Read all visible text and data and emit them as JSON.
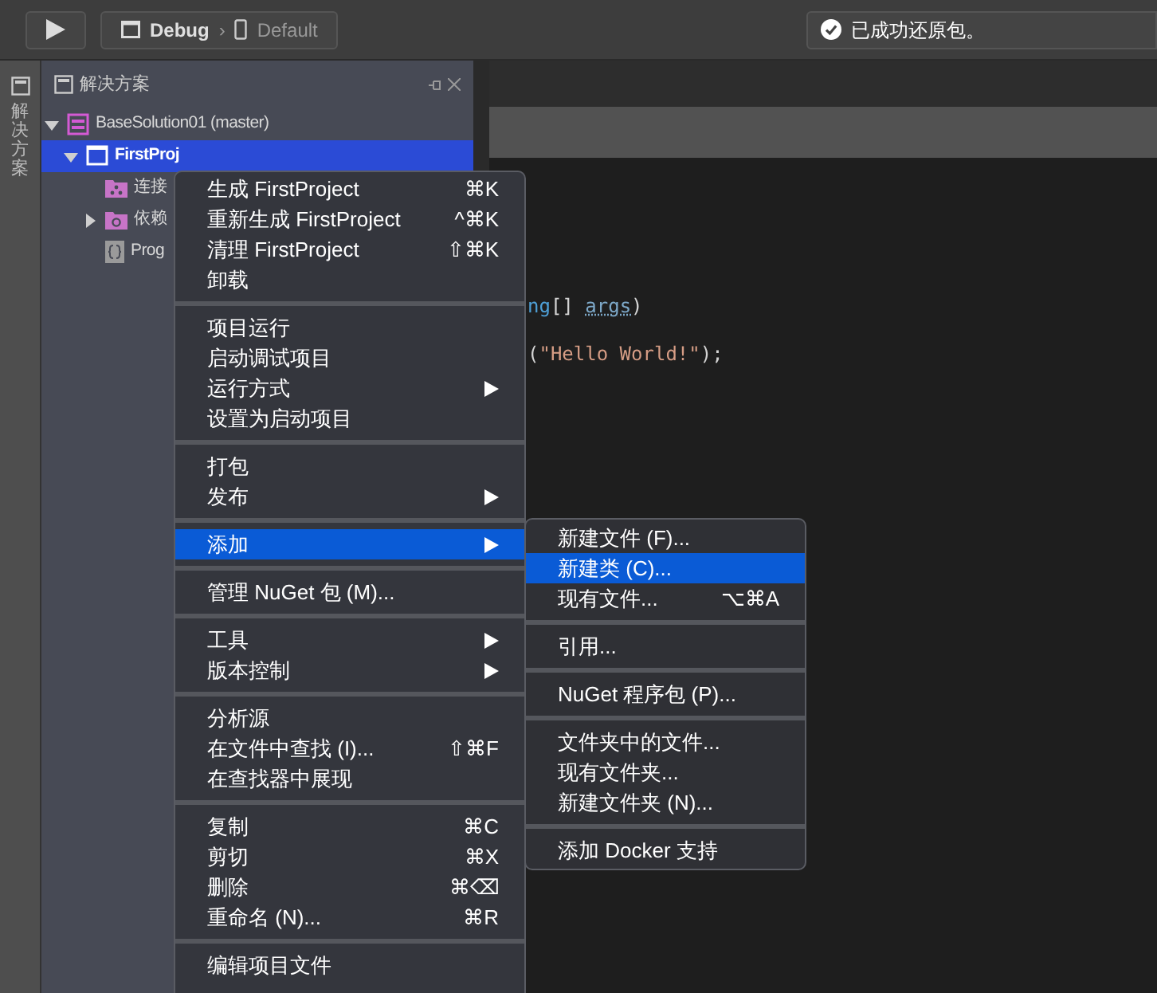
{
  "toolbar": {
    "config": "Debug",
    "separator": "›",
    "device": "Default",
    "status": "已成功还原包。"
  },
  "side_strip": {
    "label": "解决方案"
  },
  "solution_panel": {
    "title": "解决方案",
    "tree": [
      {
        "label": "BaseSolution01 (master)",
        "kind": "solution",
        "expanded": true,
        "selected": false,
        "children": [
          {
            "label": "FirstProj",
            "kind": "project",
            "expanded": true,
            "selected": true,
            "children": [
              {
                "label": "连接",
                "kind": "connected",
                "selected": false
              },
              {
                "label": "依赖",
                "kind": "dependencies",
                "expanded": false,
                "selected": false
              },
              {
                "label": "Prog",
                "kind": "code",
                "selected": false
              }
            ]
          }
        ]
      }
    ]
  },
  "code": {
    "lines": [
      {
        "segments": [
          {
            "text": "ng",
            "kind": "type"
          },
          {
            "text": "[] ",
            "kind": "plain"
          },
          {
            "text": "args",
            "kind": "param"
          },
          {
            "text": ")",
            "kind": "plain"
          }
        ]
      },
      {
        "segments": [
          {
            "text": "(",
            "kind": "plain"
          },
          {
            "text": "\"Hello World!\"",
            "kind": "string"
          },
          {
            "text": ");",
            "kind": "plain"
          }
        ]
      }
    ]
  },
  "context_menu": {
    "items": [
      {
        "kind": "item",
        "label": "生成 FirstProject",
        "shortcut": "⌘K",
        "submenu": false,
        "selected": false
      },
      {
        "kind": "item",
        "label": "重新生成 FirstProject",
        "shortcut": "^⌘K",
        "submenu": false,
        "selected": false
      },
      {
        "kind": "item",
        "label": "清理 FirstProject",
        "shortcut": "⇧⌘K",
        "submenu": false,
        "selected": false
      },
      {
        "kind": "item",
        "label": "卸载",
        "submenu": false,
        "selected": false
      },
      {
        "kind": "separator"
      },
      {
        "kind": "item",
        "label": "项目运行",
        "submenu": false,
        "selected": false
      },
      {
        "kind": "item",
        "label": "启动调试项目",
        "submenu": false,
        "selected": false
      },
      {
        "kind": "item",
        "label": "运行方式",
        "submenu": true,
        "selected": false
      },
      {
        "kind": "item",
        "label": "设置为启动项目",
        "submenu": false,
        "selected": false
      },
      {
        "kind": "separator"
      },
      {
        "kind": "item",
        "label": "打包",
        "submenu": false,
        "selected": false
      },
      {
        "kind": "item",
        "label": "发布",
        "submenu": true,
        "selected": false
      },
      {
        "kind": "separator"
      },
      {
        "kind": "item",
        "label": "添加",
        "submenu": true,
        "selected": true
      },
      {
        "kind": "separator"
      },
      {
        "kind": "item",
        "label": "管理 NuGet 包 (M)...",
        "submenu": false,
        "selected": false
      },
      {
        "kind": "separator"
      },
      {
        "kind": "item",
        "label": "工具",
        "submenu": true,
        "selected": false
      },
      {
        "kind": "item",
        "label": "版本控制",
        "submenu": true,
        "selected": false
      },
      {
        "kind": "separator"
      },
      {
        "kind": "item",
        "label": "分析源",
        "submenu": false,
        "selected": false
      },
      {
        "kind": "item",
        "label": "在文件中查找 (I)...",
        "shortcut": "⇧⌘F",
        "submenu": false,
        "selected": false
      },
      {
        "kind": "item",
        "label": "在查找器中展现",
        "submenu": false,
        "selected": false
      },
      {
        "kind": "separator"
      },
      {
        "kind": "item",
        "label": "复制",
        "shortcut": "⌘C",
        "submenu": false,
        "selected": false
      },
      {
        "kind": "item",
        "label": "剪切",
        "shortcut": "⌘X",
        "submenu": false,
        "selected": false
      },
      {
        "kind": "item",
        "label": "删除",
        "shortcut": "⌘⌫",
        "submenu": false,
        "selected": false
      },
      {
        "kind": "item",
        "label": "重命名 (N)...",
        "shortcut": "⌘R",
        "submenu": false,
        "selected": false
      },
      {
        "kind": "separator"
      },
      {
        "kind": "item",
        "label": "编辑项目文件",
        "submenu": false,
        "selected": false
      }
    ]
  },
  "submenu": {
    "items": [
      {
        "kind": "item",
        "label": "新建文件 (F)...",
        "selected": false
      },
      {
        "kind": "item",
        "label": "新建类 (C)...",
        "selected": true
      },
      {
        "kind": "item",
        "label": "现有文件...",
        "shortcut": "⌥⌘A",
        "selected": false
      },
      {
        "kind": "separator"
      },
      {
        "kind": "item",
        "label": "引用...",
        "selected": false
      },
      {
        "kind": "separator"
      },
      {
        "kind": "item",
        "label": "NuGet 程序包 (P)...",
        "selected": false
      },
      {
        "kind": "separator"
      },
      {
        "kind": "item",
        "label": "文件夹中的文件...",
        "selected": false
      },
      {
        "kind": "item",
        "label": "现有文件夹...",
        "selected": false
      },
      {
        "kind": "item",
        "label": "新建文件夹 (N)...",
        "selected": false
      },
      {
        "kind": "separator"
      },
      {
        "kind": "item",
        "label": "添加 Docker 支持",
        "selected": false
      }
    ]
  }
}
